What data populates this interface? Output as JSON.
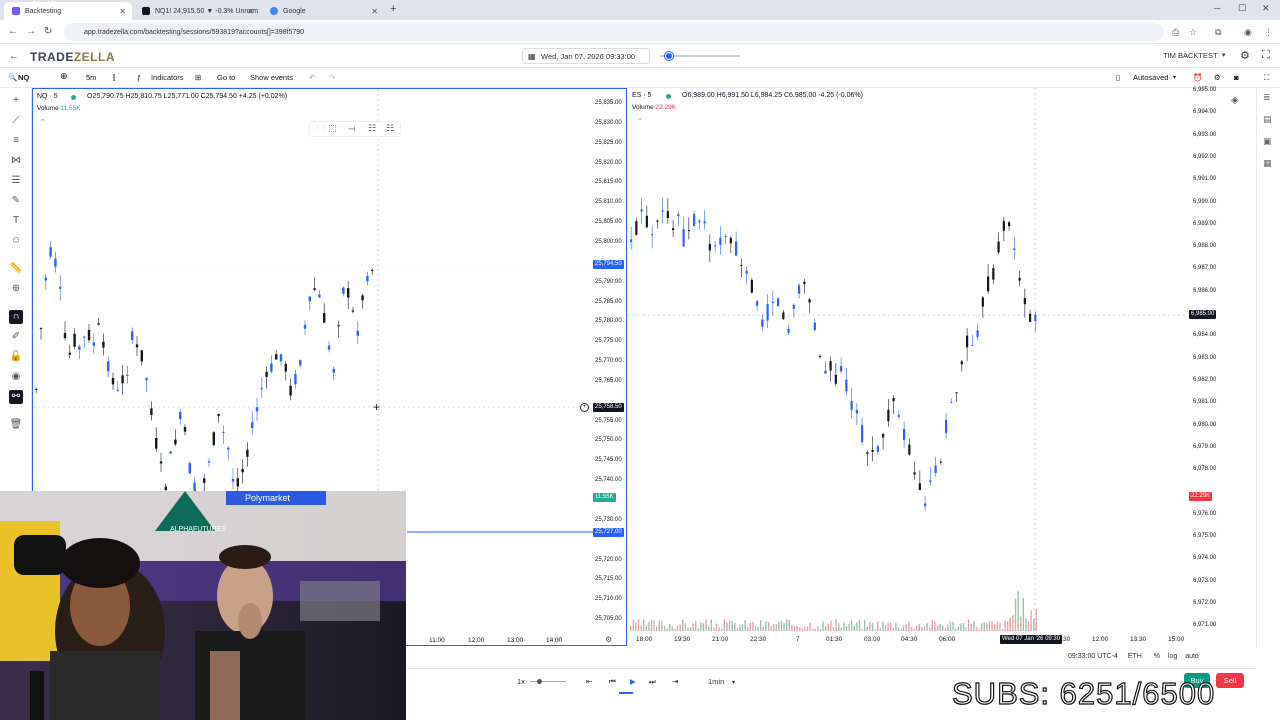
{
  "browser": {
    "tabs": [
      {
        "label": "Backtesting",
        "color": "#7a5af8"
      },
      {
        "label": "NQ1! 24,915.50 ▼ -0.3% Unnam",
        "color": "#131722"
      },
      {
        "label": "Google",
        "color": "#4285f4"
      }
    ],
    "url": "app.tradezella.com/backtesting/sessions/593819?accounts[]=398f5790"
  },
  "app": {
    "logo_a": "TRADE",
    "logo_b": "ZELLA",
    "datetime": "Wed, Jan 07, 2026 09:33:00",
    "user": "TIM BACKTEST",
    "autosaved": "Autosaved"
  },
  "toolbar": {
    "symbol": "NQ",
    "interval": "5m",
    "indicators": "Indicators",
    "goto": "Go to",
    "show_events": "Show events"
  },
  "left_chart": {
    "title": "NQ · 5",
    "ohlc": "O25,790.75 H25,810.75 L25,771.00 C25,794.50 +4.25 (+0.02%)",
    "volume_label": "Volume",
    "volume_value": "11.55K",
    "price_ticks": [
      "25,835.00",
      "25,830.00",
      "25,825.00",
      "25,820.00",
      "25,815.00",
      "25,810.00",
      "25,805.00",
      "25,800.00",
      "25,794.50",
      "25,790.00",
      "25,785.00",
      "25,780.00",
      "25,775.00",
      "25,770.00",
      "25,765.00",
      "25,758.50",
      "25,755.00",
      "25,750.00",
      "25,745.00",
      "25,740.00",
      "11.55K",
      "25,730.00",
      "25,727.00",
      "25,720.00",
      "25,715.00",
      "25,710.00",
      "25,705.00"
    ],
    "current_price": "25,794.50",
    "cursor_price": "25,758.50",
    "vol_tag": "11.55K",
    "line_price": "25,727.00",
    "time_ticks": [
      "11:00",
      "12:00",
      "13:00",
      "14:00"
    ]
  },
  "right_chart": {
    "title": "ES · 5",
    "ohlc": "O6,989.00 H6,991.50 L6,984.25 C6,985.00 -4.25 (-0.06%)",
    "volume_label": "Volume",
    "volume_value": "22.29K",
    "price_ticks": [
      "6,995.00",
      "6,994.00",
      "6,993.00",
      "6,992.00",
      "6,991.00",
      "6,990.00",
      "6,989.00",
      "6,988.00",
      "6,987.00",
      "6,986.00",
      "6,985.00",
      "6,984.00",
      "6,983.00",
      "6,982.00",
      "6,981.00",
      "6,980.00",
      "6,979.00",
      "6,978.00",
      "22.29K",
      "6,976.00",
      "6,975.00",
      "6,974.00",
      "6,973.00",
      "6,972.00",
      "6,971.00"
    ],
    "current_price": "6,985.00",
    "vol_tag": "22.29K",
    "time_ticks": [
      "18:00",
      "19:30",
      "21:00",
      "22:30",
      "7",
      "01:30",
      "03:00",
      "04:30",
      "06:00",
      "07:30",
      "09:00",
      "10:30",
      "12:00",
      "13:30",
      "15:00"
    ],
    "crosshair_time": "Wed 07 Jan '26  09:30"
  },
  "status": {
    "timezone": "09:33:00 UTC-4",
    "session": "ETH",
    "pct": "%",
    "log": "log",
    "auto": "auto"
  },
  "playback": {
    "speed": "1x",
    "interval": "1min",
    "buy": "Buy",
    "sell": "Sell"
  },
  "overlay": {
    "subs": "SUBS: 6251/6500",
    "banner_text": "Polymarket",
    "logo_text": "ALPHAFUTURES"
  },
  "colors": {
    "accent": "#2962ff",
    "up": "#2962ff",
    "down": "#131722",
    "buy": "#089981",
    "sell": "#f23645"
  }
}
